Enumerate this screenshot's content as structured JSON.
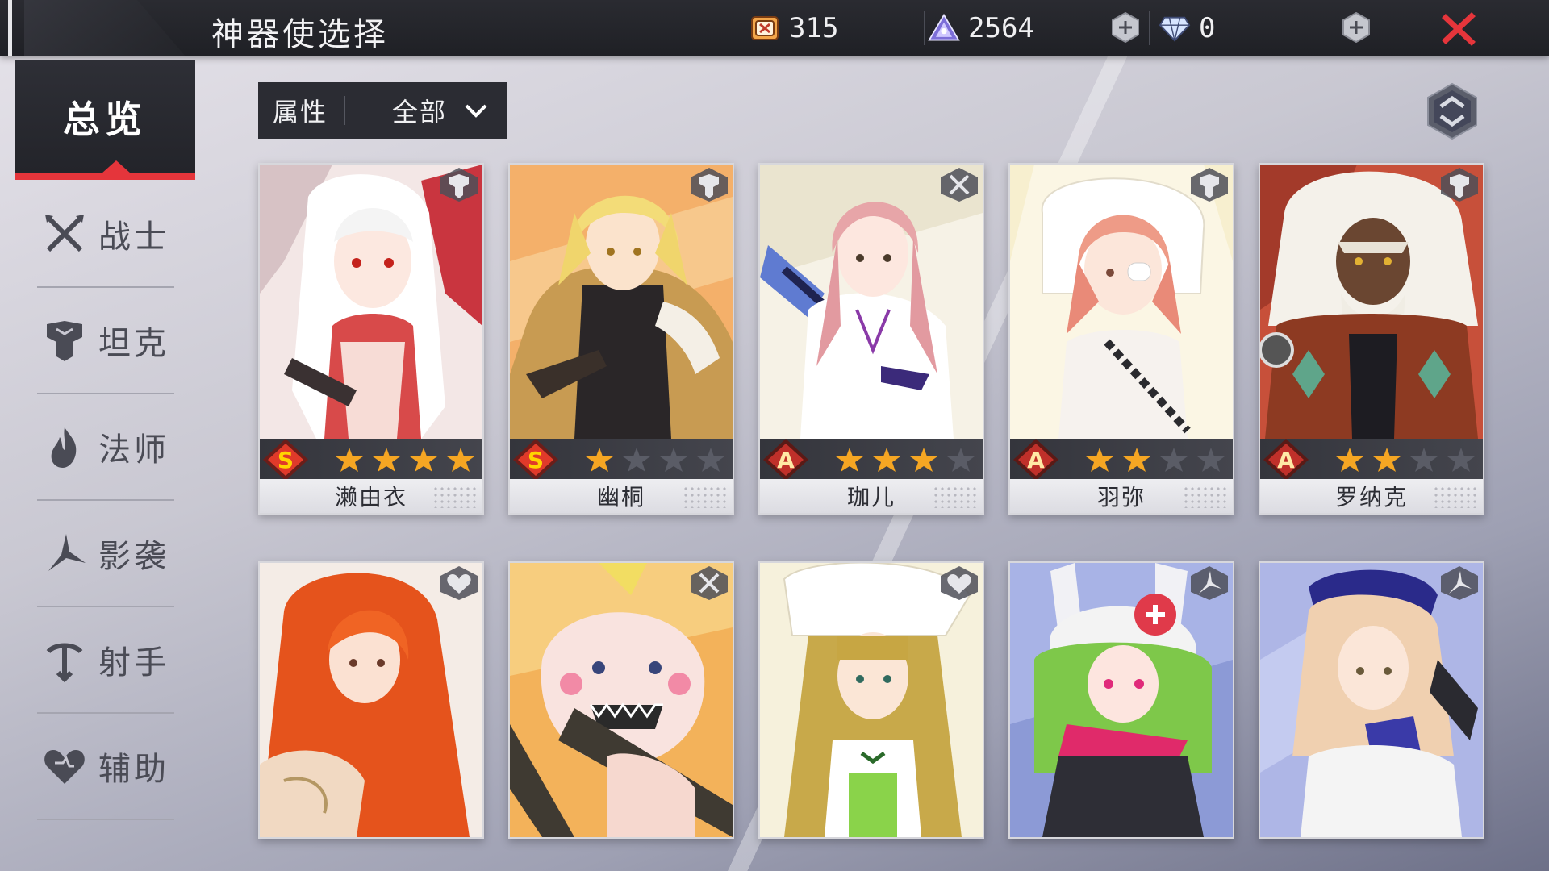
{
  "header": {
    "title": "神器使选择",
    "currencies": [
      {
        "icon": "ticket-icon",
        "value": "315"
      },
      {
        "icon": "crystal-pyramid-icon",
        "value": "2564"
      },
      {
        "icon": "diamond-icon",
        "value": "0"
      }
    ]
  },
  "sidebar": {
    "overview": "总览",
    "items": [
      {
        "label": "战士",
        "icon": "crossed-swords-icon"
      },
      {
        "label": "坦克",
        "icon": "shield-icon"
      },
      {
        "label": "法师",
        "icon": "flame-icon"
      },
      {
        "label": "影袭",
        "icon": "shuriken-icon"
      },
      {
        "label": "射手",
        "icon": "bow-icon"
      },
      {
        "label": "辅助",
        "icon": "heart-icon"
      }
    ]
  },
  "filter": {
    "label": "属性",
    "value": "全部"
  },
  "colors": {
    "accent": "#e5353b",
    "star_on": "#f5a623",
    "star_off": "#5a5c66",
    "rank_s": "#e03a2a",
    "rank_a": "#c0302a"
  },
  "cards": [
    {
      "name": "濑由衣",
      "grade": "S",
      "stars_lit": 4,
      "stars_total": 4,
      "class_icon": "shield-icon"
    },
    {
      "name": "幽桐",
      "grade": "S",
      "stars_lit": 1,
      "stars_total": 4,
      "class_icon": "shield-icon"
    },
    {
      "name": "珈儿",
      "grade": "A",
      "stars_lit": 3,
      "stars_total": 4,
      "class_icon": "crossed-swords-icon"
    },
    {
      "name": "羽弥",
      "grade": "A",
      "stars_lit": 2,
      "stars_total": 4,
      "class_icon": "shield-icon"
    },
    {
      "name": "罗纳克",
      "grade": "A",
      "stars_lit": 2,
      "stars_total": 4,
      "class_icon": "shield-icon"
    },
    {
      "name": "",
      "class_icon": "heart-icon"
    },
    {
      "name": "",
      "class_icon": "crossed-swords-icon"
    },
    {
      "name": "",
      "class_icon": "heart-icon"
    },
    {
      "name": "",
      "class_icon": "shuriken-icon"
    },
    {
      "name": "",
      "class_icon": "shuriken-icon"
    }
  ]
}
